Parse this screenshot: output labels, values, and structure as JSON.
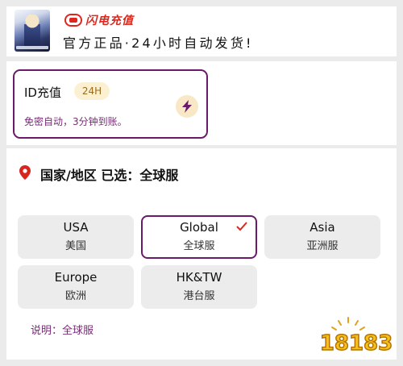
{
  "header": {
    "brand_name": "闪电充值",
    "tagline": "官方正品·24小时自动发货!"
  },
  "recharge": {
    "title": "ID充值",
    "badge": "24H",
    "description": "免密自动，3分钟到账。"
  },
  "region": {
    "title": "国家/地区 已选：全球服",
    "servers": [
      {
        "en": "USA",
        "zh": "美国",
        "selected": false
      },
      {
        "en": "Global",
        "zh": "全球服",
        "selected": true
      },
      {
        "en": "Asia",
        "zh": "亚洲服",
        "selected": false
      },
      {
        "en": "Europe",
        "zh": "欧洲",
        "selected": false
      },
      {
        "en": "HK&TW",
        "zh": "港台服",
        "selected": false
      }
    ],
    "note": "说明：全球服"
  },
  "watermark": {
    "text": "18183"
  },
  "colors": {
    "accent": "#6b1a6a",
    "brand_red": "#d82a20",
    "badge_bg": "#fbf1d2",
    "location_pin": "#d9261c"
  }
}
